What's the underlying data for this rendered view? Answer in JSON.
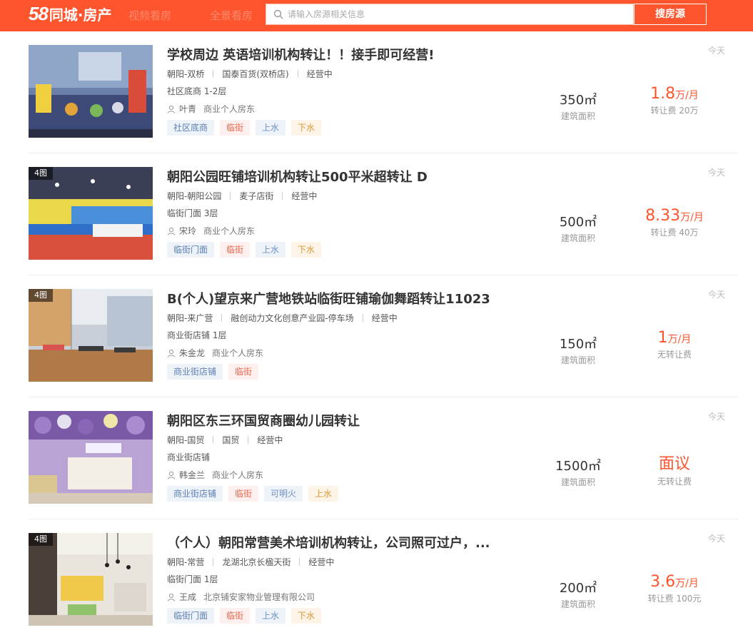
{
  "header": {
    "logo_58": "58",
    "logo_text": "同城·房产",
    "nav_video": "视频看房",
    "nav_panorama": "全景看房",
    "search_placeholder": "请输入房源相关信息",
    "search_button": "搜房源",
    "brand_color": "#ff552e"
  },
  "listings": [
    {
      "title": "学校周边 英语培训机构转让！！接手即可经营!",
      "date": "今天",
      "pic_count": "",
      "district": "朝阳-双桥",
      "location": "国泰百货(双桥店)",
      "status": "经营中",
      "floor": "社区底商 1-2层",
      "owner_name": "叶青",
      "owner_type": "商业个人房东",
      "tags": [
        "社区底商",
        "临街",
        "上水",
        "下水"
      ],
      "area": "350㎡",
      "area_label": "建筑面积",
      "price_num": "1.8",
      "price_unit": "万/月",
      "price_note": "转让费 20万"
    },
    {
      "title": "朝阳公园旺铺培训机构转让500平米超转让 D",
      "date": "今天",
      "pic_count": "4图",
      "district": "朝阳-朝阳公园",
      "location": "麦子店街",
      "status": "经营中",
      "floor": "临街门面 3层",
      "owner_name": "宋玲",
      "owner_type": "商业个人房东",
      "tags": [
        "临街门面",
        "临街",
        "上水",
        "下水"
      ],
      "area": "500㎡",
      "area_label": "建筑面积",
      "price_num": "8.33",
      "price_unit": "万/月",
      "price_note": "转让费 40万"
    },
    {
      "title": "B(个人)望京来广营地铁站临街旺铺瑜伽舞蹈转让11023",
      "date": "今天",
      "pic_count": "4图",
      "district": "朝阳-来广营",
      "location": "融创动力文化创意产业园-停车场",
      "status": "经营中",
      "floor": "商业街店铺 1层",
      "owner_name": "朱金龙",
      "owner_type": "商业个人房东",
      "tags": [
        "商业街店铺",
        "临街"
      ],
      "area": "150㎡",
      "area_label": "建筑面积",
      "price_num": "1",
      "price_unit": "万/月",
      "price_note": "无转让费"
    },
    {
      "title": "朝阳区东三环国贸商圈幼儿园转让",
      "date": "今天",
      "pic_count": "",
      "district": "朝阳-国贸",
      "location": "国贸",
      "status": "经营中",
      "floor": "商业街店铺",
      "owner_name": "韩金兰",
      "owner_type": "商业个人房东",
      "tags": [
        "商业街店铺",
        "临街",
        "可明火",
        "上水"
      ],
      "area": "1500㎡",
      "area_label": "建筑面积",
      "price_num": "面议",
      "price_unit": "",
      "price_note": "无转让费"
    },
    {
      "title": "（个人）朝阳常营美术培训机构转让，公司照可过户，...",
      "date": "今天",
      "pic_count": "4图",
      "district": "朝阳-常营",
      "location": "龙湖北京长楹天街",
      "status": "经营中",
      "floor": "临街门面 1层",
      "owner_name": "王成",
      "owner_type": "北京铺安家物业管理有限公司",
      "tags": [
        "临街门面",
        "临街",
        "上水",
        "下水"
      ],
      "area": "200㎡",
      "area_label": "建筑面积",
      "price_num": "3.6",
      "price_unit": "万/月",
      "price_note": "转让费 100元"
    }
  ]
}
